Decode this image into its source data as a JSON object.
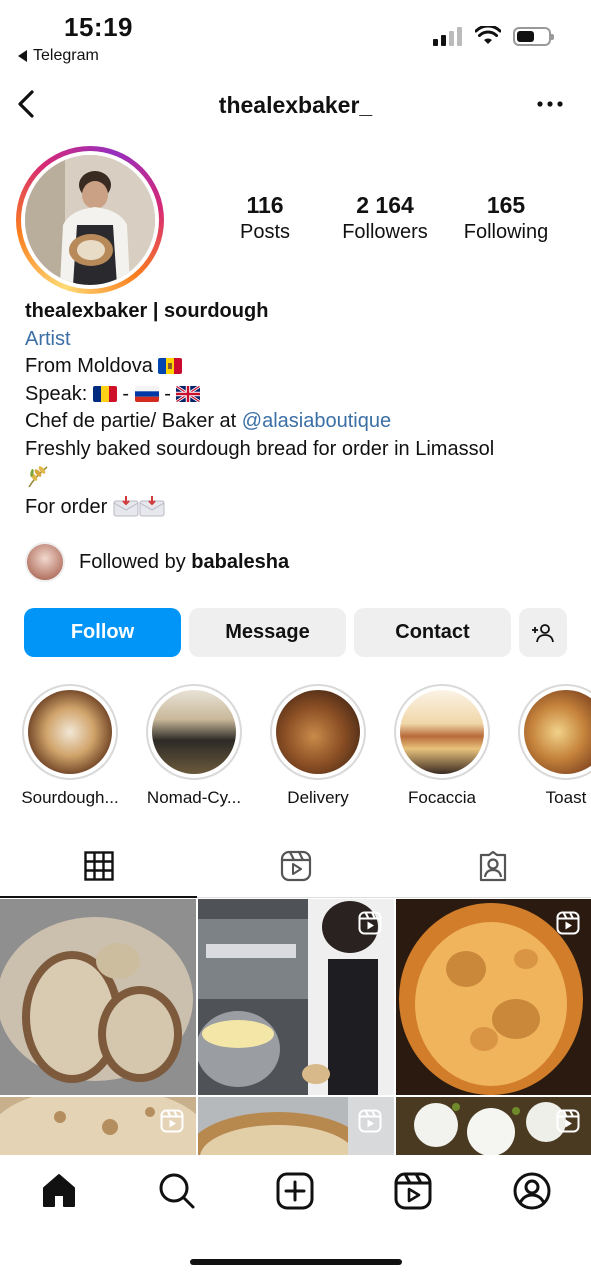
{
  "status_bar": {
    "time": "15:19",
    "back_app": "Telegram"
  },
  "header": {
    "username": "thealexbaker_"
  },
  "profile": {
    "stats": [
      {
        "value": "116",
        "label": "Posts"
      },
      {
        "value": "2 164",
        "label": "Followers"
      },
      {
        "value": "165",
        "label": "Following"
      }
    ],
    "bio": {
      "name": "thealexbaker | sourdough",
      "category": "Artist",
      "line_from": "From Moldova",
      "line_speak": "Speak:",
      "line_chef_prefix": "Chef de partie/ Baker at ",
      "mention": "@alasiaboutique",
      "line_fresh": "Freshly baked sourdough bread for order in Limassol",
      "line_order": "For order"
    },
    "followed_by_prefix": "Followed by ",
    "followed_by_user": "babalesha"
  },
  "actions": {
    "follow": "Follow",
    "message": "Message",
    "contact": "Contact"
  },
  "highlights": [
    {
      "label": "Sourdough..."
    },
    {
      "label": "Nomad-Cy..."
    },
    {
      "label": "Delivery"
    },
    {
      "label": "Focaccia"
    },
    {
      "label": "Toast"
    }
  ],
  "colors": {
    "accent": "#0095f6",
    "link": "#3b6fa6",
    "button_gray": "#efefef"
  }
}
